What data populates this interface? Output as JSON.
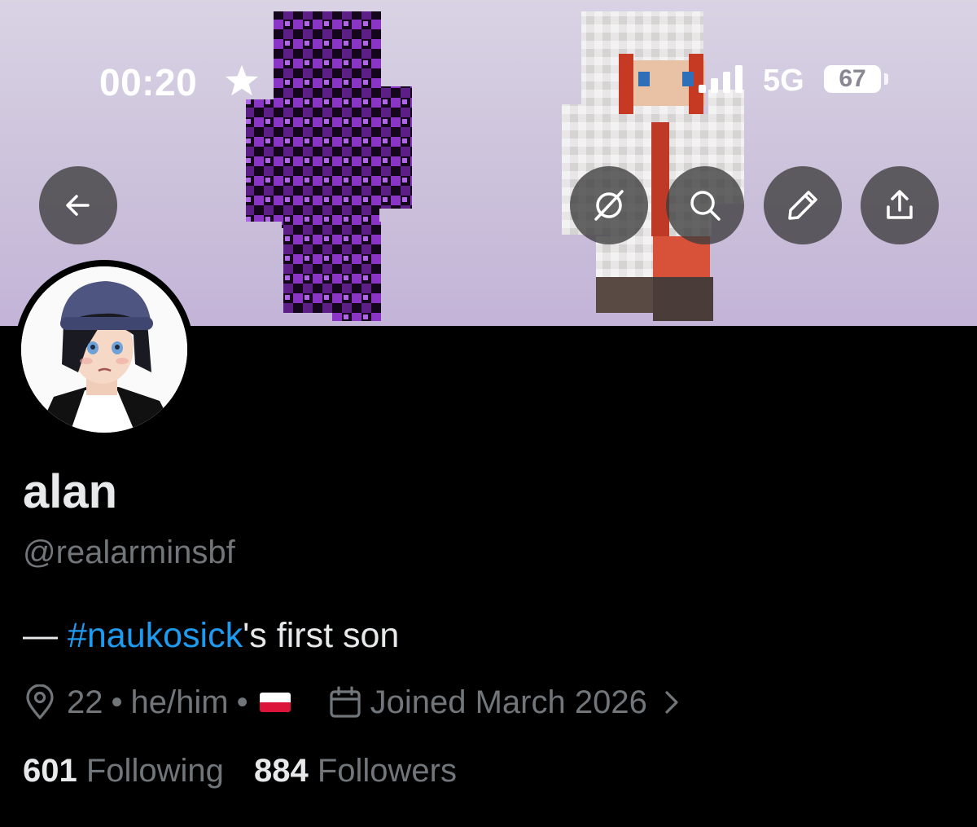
{
  "status_bar": {
    "time": "00:20",
    "network": "5G",
    "battery": "67"
  },
  "header_actions": {
    "back": "back-arrow-icon",
    "grok": "grok-icon",
    "search": "search-icon",
    "edit": "pencil-icon",
    "share": "share-icon"
  },
  "profile": {
    "name": "alan",
    "handle": "@realarminsbf",
    "bio_prefix": "— ",
    "bio_hashtag": "#naukosick",
    "bio_suffix": "'s first son",
    "age": "22",
    "separator": "•",
    "pronouns": "he/him",
    "joined": "Joined March 2026",
    "following_count": "601",
    "following_label": "Following",
    "followers_count": "884",
    "followers_label": "Followers"
  },
  "colors": {
    "background": "#000000",
    "text_primary": "#e7e9ea",
    "text_secondary": "#71767b",
    "link": "#1d9bf0"
  }
}
